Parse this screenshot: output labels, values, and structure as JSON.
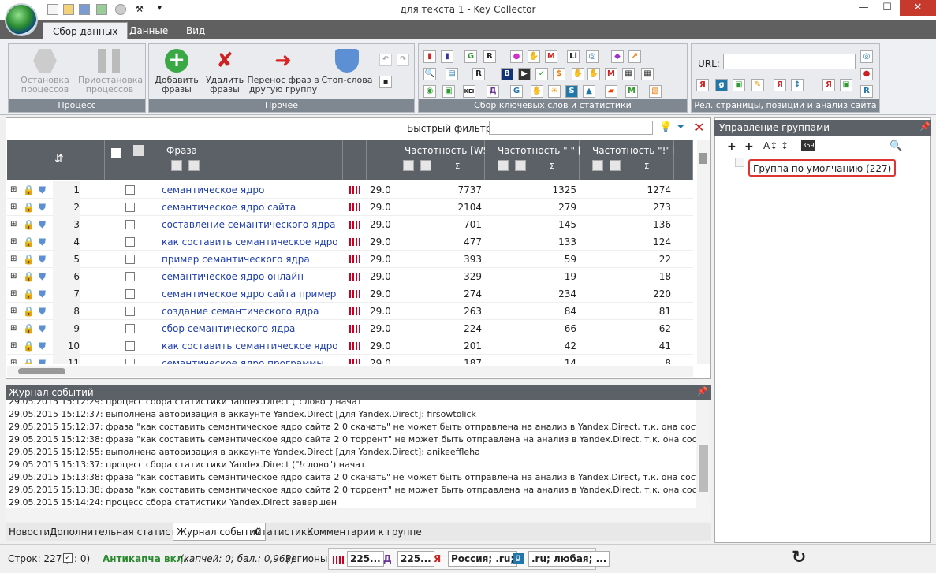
{
  "window": {
    "title": "для текста 1 - Key Collector"
  },
  "ribbon": {
    "tabs": [
      "Сбор данных",
      "Данные",
      "Вид"
    ],
    "groups": {
      "process": {
        "label": "Процесс",
        "stop": "Остановка\nпроцессов",
        "pause": "Приостановка\nпроцессов"
      },
      "other": {
        "label": "Прочее",
        "add": "Добавить\nфразы",
        "delete": "Удалить\nфразы",
        "move": "Перенос фраз в\nдругую группу",
        "stop_words": "Стоп-слова"
      },
      "collect": {
        "label": "Сбор ключевых слов и статистики"
      },
      "rel": {
        "label": "Рел. страницы, позиции и анализ сайта",
        "url_label": "URL:",
        "url_value": ""
      }
    }
  },
  "filter": {
    "label": "Быстрый фильтр:",
    "value": ""
  },
  "grid": {
    "headers": {
      "phrase": "Фраза",
      "freq_ws": "Частотность [WS",
      "freq_q": "Частотность \" \" [",
      "freq_ex": "Частотность \"!\" [",
      "sigma": "Σ"
    },
    "rows": [
      {
        "n": "1",
        "phrase": "семантическое ядро",
        "v": "29.0",
        "ws": "7737",
        "q": "1325",
        "ex": "1274"
      },
      {
        "n": "2",
        "phrase": "семантическое ядро сайта",
        "v": "29.0",
        "ws": "2104",
        "q": "279",
        "ex": "273"
      },
      {
        "n": "3",
        "phrase": "составление семантического ядра",
        "v": "29.0",
        "ws": "701",
        "q": "145",
        "ex": "136"
      },
      {
        "n": "4",
        "phrase": "как составить семантическое ядро",
        "v": "29.0",
        "ws": "477",
        "q": "133",
        "ex": "124"
      },
      {
        "n": "5",
        "phrase": "пример семантического ядра",
        "v": "29.0",
        "ws": "393",
        "q": "59",
        "ex": "22"
      },
      {
        "n": "6",
        "phrase": "семантическое ядро онлайн",
        "v": "29.0",
        "ws": "329",
        "q": "19",
        "ex": "18"
      },
      {
        "n": "7",
        "phrase": "семантическое ядро сайта пример",
        "v": "29.0",
        "ws": "274",
        "q": "234",
        "ex": "220"
      },
      {
        "n": "8",
        "phrase": "создание семантического ядра",
        "v": "29.0",
        "ws": "263",
        "q": "84",
        "ex": "81"
      },
      {
        "n": "9",
        "phrase": "сбор семантического ядра",
        "v": "29.0",
        "ws": "224",
        "q": "66",
        "ex": "62"
      },
      {
        "n": "10",
        "phrase": "как составить семантическое ядро сайта",
        "v": "29.0",
        "ws": "201",
        "q": "42",
        "ex": "41"
      },
      {
        "n": "11",
        "phrase": "семантическое ядро программы",
        "v": "29.0",
        "ws": "187",
        "q": "14",
        "ex": "8"
      }
    ]
  },
  "groups_panel": {
    "title": "Управление группами",
    "item": "Группа по умолчанию (227)"
  },
  "log": {
    "title": "Журнал событий",
    "lines": [
      "29.05.2015 15:12:29: процесс сбора статистики Yandex.Direct (\"слово\") начат",
      "29.05.2015 15:12:37: выполнена авторизация в аккаунте Yandex.Direct [для Yandex.Direct]: firsowtolick",
      "29.05.2015 15:12:37: фраза \"как составить семантическое ядро сайта 2 0 скачать\" не может быть отправлена на анализ в Yandex.Direct, т.к. она состоит более ч",
      "29.05.2015 15:12:38: фраза \"как составить семантическое ядро сайта 2 0 торрент\" не может быть отправлена на анализ в Yandex.Direct, т.к. она состоит более",
      "29.05.2015 15:12:55: выполнена авторизация в аккаунте Yandex.Direct [для Yandex.Direct]: anikeeffleha",
      "29.05.2015 15:13:37: процесс сбора статистики Yandex.Direct (\"!слово\") начат",
      "29.05.2015 15:13:38: фраза \"как составить семантическое ядро сайта 2 0 скачать\" не может быть отправлена на анализ в Yandex.Direct, т.к. она состоит более ч",
      "29.05.2015 15:13:38: фраза \"как составить семантическое ядро сайта 2 0 торрент\" не может быть отправлена на анализ в Yandex.Direct, т.к. она состоит более",
      "29.05.2015 15:14:24: процесс сбора статистики Yandex.Direct завершен"
    ]
  },
  "bottom_tabs": [
    "Новости",
    "Дополнительная статистика",
    "Журнал событий",
    "Статистика",
    "Комментарии к группе"
  ],
  "status": {
    "rows_prefix": "Строк: 227 (",
    "rows_suffix": ": 0)",
    "anticaptcha": "Антикапча вкл.",
    "captcha_info": "(капчей: 0; бал.: 0,96$)",
    "regions_label": "Регионы:",
    "chip1": "225...",
    "chip2": "225...",
    "chip3": "Россия; .ru;",
    "chip4": ".ru; любая; ..."
  }
}
